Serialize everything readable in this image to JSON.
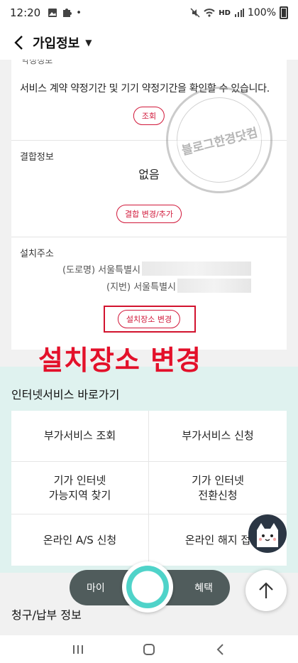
{
  "status_bar": {
    "time": "12:20",
    "network": "HD",
    "battery": "100%"
  },
  "header": {
    "title": "가입정보"
  },
  "contract": {
    "cut_label": "약정정보",
    "text": "서비스 계약 약정기간 및 기기 약정기간을 확인할 수 있습니다.",
    "button": "조회"
  },
  "combine": {
    "label": "결합정보",
    "value": "없음",
    "button": "결합 변경/추가"
  },
  "address": {
    "label": "설치주소",
    "road": "(도로명) 서울특별시",
    "lot": "(지번) 서울특별시",
    "button": "설치장소 변경"
  },
  "watermark": {
    "text": "블로그한경닷컴"
  },
  "annotation": {
    "text": "설치장소 변경"
  },
  "shortcuts": {
    "title": "인터넷서비스 바로가기",
    "items": [
      {
        "label": "부가서비스 조회"
      },
      {
        "label": "부가서비스 신청"
      },
      {
        "label": "기가 인터넷\n가능지역 찾기"
      },
      {
        "label": "기가 인터넷\n전환신청"
      },
      {
        "label": "온라인 A/S 신청"
      },
      {
        "label": "온라인 해지 접"
      }
    ]
  },
  "billing": {
    "title": "청구/납부 정보"
  },
  "tabbar": {
    "left": "마이",
    "right": "혜택"
  },
  "colors": {
    "accent_red": "#d1183a",
    "mint_bg": "#dff2ef",
    "tabbar": "#505c5c",
    "teal": "#2db5ad"
  }
}
